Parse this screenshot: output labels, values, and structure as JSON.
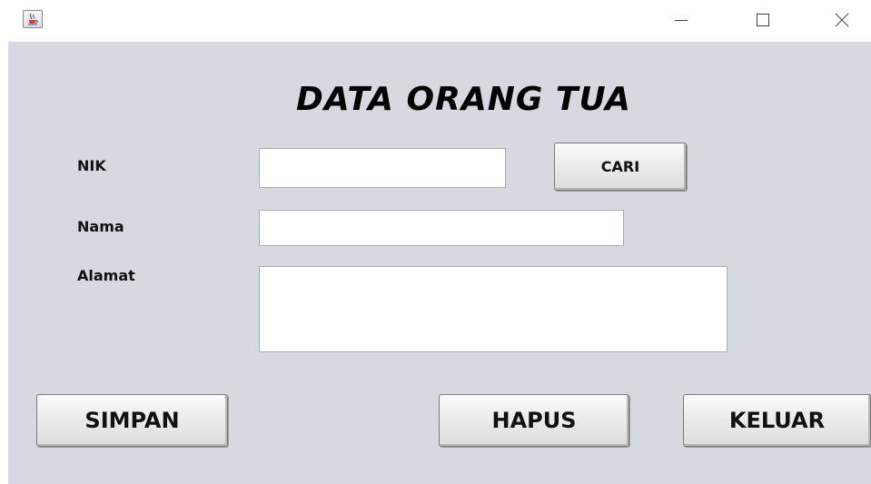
{
  "window": {
    "icons": {
      "app": "java-cup-icon",
      "minimize": "minimize-icon",
      "maximize": "maximize-icon",
      "close": "close-icon"
    }
  },
  "form": {
    "title": "DATA ORANG TUA",
    "nik": {
      "label": "NIK",
      "value": ""
    },
    "nama": {
      "label": "Nama",
      "value": ""
    },
    "alamat": {
      "label": "Alamat",
      "value": ""
    }
  },
  "buttons": {
    "cari": "CARI",
    "simpan": "SIMPAN",
    "hapus": "HAPUS",
    "keluar": "KELUAR"
  },
  "colors": {
    "panel_bg": "#d6d9df",
    "field_bg": "#ffffff",
    "button_face": "#ececec"
  }
}
